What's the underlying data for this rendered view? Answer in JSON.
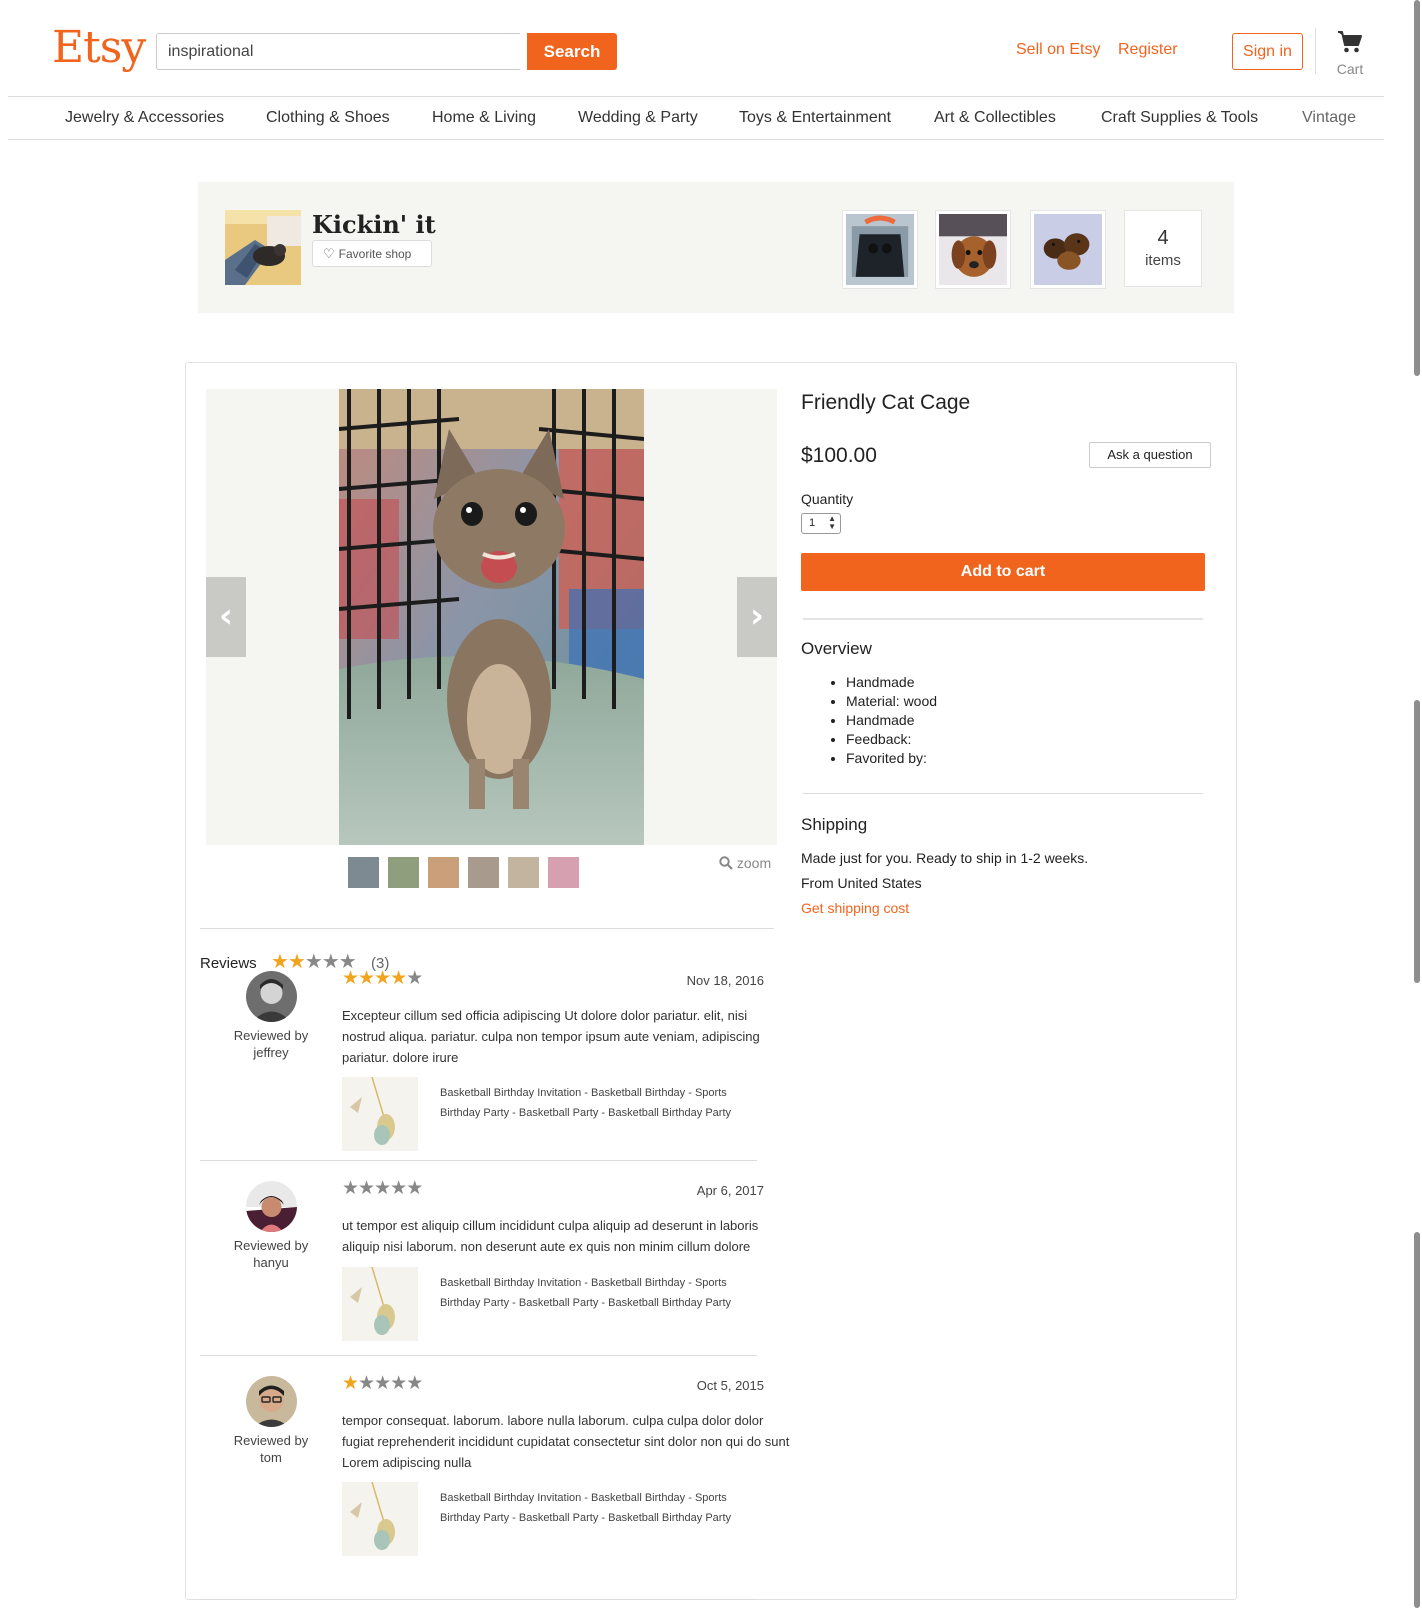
{
  "header": {
    "logo": "Etsy",
    "search_value": "inspirational",
    "search_button": "Search",
    "sell_link": "Sell on Etsy",
    "register_link": "Register",
    "signin_button": "Sign in",
    "cart_label": "Cart"
  },
  "categories": [
    "Jewelry & Accessories",
    "Clothing & Shoes",
    "Home & Living",
    "Wedding & Party",
    "Toys & Entertainment",
    "Art & Collectibles",
    "Craft Supplies & Tools",
    "Vintage"
  ],
  "shop": {
    "name": "Kickin' it",
    "favorite_label": "Favorite shop",
    "items_count": "4",
    "items_label": "items"
  },
  "listing": {
    "title": "Friendly Cat Cage",
    "price": "$100.00",
    "ask_button": "Ask a question",
    "quantity_label": "Quantity",
    "quantity_value": "1",
    "add_to_cart": "Add to cart",
    "zoom_label": "zoom",
    "overview_title": "Overview",
    "overview_items": [
      "Handmade",
      "Material: wood",
      "Handmade",
      "Feedback:",
      "Favorited by:"
    ],
    "shipping_title": "Shipping",
    "shipping_lines": [
      "Made just for you. Ready to ship in 1-2 weeks.",
      "From United States"
    ],
    "shipping_link": "Get shipping cost"
  },
  "reviews": {
    "title": "Reviews",
    "rating": 2,
    "count": "(3)",
    "items": [
      {
        "reviewed_by": "Reviewed by",
        "user": "jeffrey",
        "rating": 4,
        "date": "Nov 18, 2016",
        "text": "Excepteur cillum sed officia adipiscing Ut dolore dolor pariatur. elit, nisi nostrud aliqua. pariatur. culpa non tempor ipsum aute veniam, adipiscing pariatur. dolore irure",
        "product": "Basketball Birthday Invitation - Basketball Birthday - Sports Birthday Party - Basketball Party - Basketball Birthday Party"
      },
      {
        "reviewed_by": "Reviewed by",
        "user": "hanyu",
        "rating": 0,
        "date": "Apr 6, 2017",
        "text": "ut tempor est aliquip cillum incididunt culpa aliquip ad deserunt in laboris aliquip nisi laborum. non deserunt aute ex quis non minim cillum dolore",
        "product": "Basketball Birthday Invitation - Basketball Birthday - Sports Birthday Party - Basketball Party - Basketball Birthday Party"
      },
      {
        "reviewed_by": "Reviewed by",
        "user": "tom",
        "rating": 1,
        "date": "Oct 5, 2015",
        "text": "tempor consequat. laborum. labore nulla laborum. culpa culpa dolor dolor fugiat reprehenderit incididunt cupidatat consectetur sint dolor non qui do sunt Lorem adipiscing nulla",
        "product": "Basketball Birthday Invitation - Basketball Birthday - Sports Birthday Party - Basketball Party - Basketball Birthday Party"
      }
    ]
  },
  "colors": {
    "brand": "#f1641e",
    "star_on": "#f1a41e",
    "star_off": "#888888"
  }
}
